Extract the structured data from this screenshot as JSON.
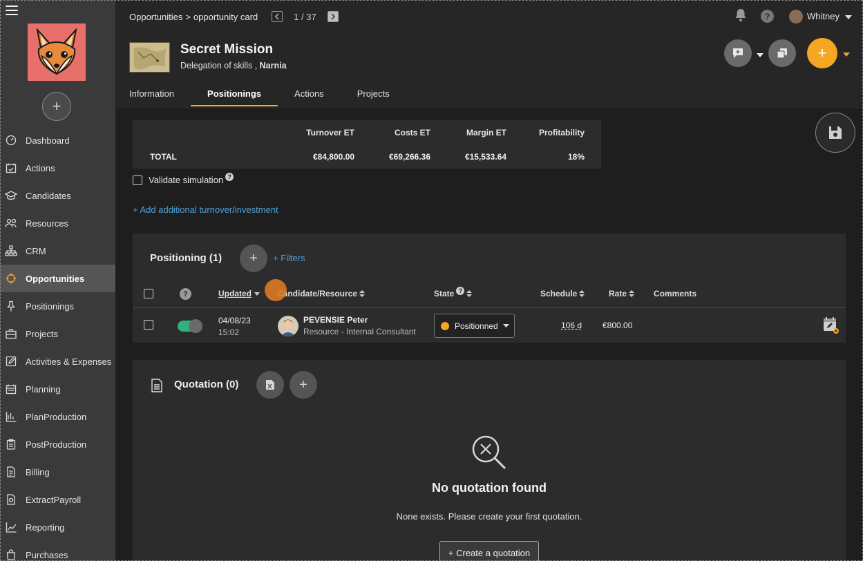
{
  "sidebar": {
    "items": [
      {
        "label": "Dashboard",
        "icon": "dashboard-icon"
      },
      {
        "label": "Actions",
        "icon": "calendar-check-icon"
      },
      {
        "label": "Candidates",
        "icon": "graduation-cap-icon"
      },
      {
        "label": "Resources",
        "icon": "users-icon"
      },
      {
        "label": "CRM",
        "icon": "network-icon"
      },
      {
        "label": "Opportunities",
        "icon": "crosshair-icon"
      },
      {
        "label": "Positionings",
        "icon": "pin-icon"
      },
      {
        "label": "Projects",
        "icon": "briefcase-icon"
      },
      {
        "label": "Activities & Expenses",
        "icon": "edit-icon"
      },
      {
        "label": "Planning",
        "icon": "calendar-icon"
      },
      {
        "label": "PlanProduction",
        "icon": "bar-chart-icon"
      },
      {
        "label": "PostProduction",
        "icon": "clipboard-icon"
      },
      {
        "label": "Billing",
        "icon": "invoice-icon"
      },
      {
        "label": "ExtractPayroll",
        "icon": "payroll-icon"
      },
      {
        "label": "Reporting",
        "icon": "line-chart-icon"
      },
      {
        "label": "Purchases",
        "icon": "bag-icon"
      }
    ],
    "active": "Opportunities"
  },
  "header": {
    "breadcrumb": {
      "root": "Opportunities",
      "separator": ">",
      "current": "opportunity card"
    },
    "pager": "1 / 37",
    "user": "Whitney",
    "help": "?",
    "opportunity": {
      "title": "Secret Mission",
      "subtitle_prefix": "Delegation of skills ,",
      "subtitle_place": "Narnia"
    },
    "add_label": "+",
    "tabs": [
      {
        "label": "Information"
      },
      {
        "label": "Positionings"
      },
      {
        "label": "Actions"
      },
      {
        "label": "Projects"
      }
    ]
  },
  "totals": {
    "headers": [
      "Turnover ET",
      "Costs ET",
      "Margin ET",
      "Profitability"
    ],
    "row_label": "TOTAL",
    "values": [
      "€84,800.00",
      "€69,266.36",
      "€15,533.64",
      "18%"
    ]
  },
  "validate": {
    "label": "Validate simulation",
    "help": "?"
  },
  "add_turnover_link": "+ Add additional turnover/investment",
  "positioning": {
    "title": "Positioning (1)",
    "add_label": "+",
    "filters_label": "+ Filters",
    "help": "?",
    "columns": [
      "Updated",
      "Candidate/Resource",
      "State",
      "Schedule",
      "Rate",
      "Comments"
    ],
    "rows": [
      {
        "date": "04/08/23",
        "time": "15:02",
        "name": "PEVENSIE Peter",
        "role": "Resource - Internal Consultant",
        "state": "Positionned",
        "schedule": "106 d",
        "rate": "€800.00"
      }
    ]
  },
  "quotation": {
    "title": "Quotation (0)",
    "add_label": "+",
    "empty_title": "No quotation found",
    "empty_text": "None exists. Please create your first quotation.",
    "create_label": "+ Create a quotation"
  },
  "colors": {
    "accent": "#f5a623",
    "link": "#4fa3d8",
    "toggle_on": "#2db37d",
    "sidebar_bg": "#3a3a3a"
  }
}
